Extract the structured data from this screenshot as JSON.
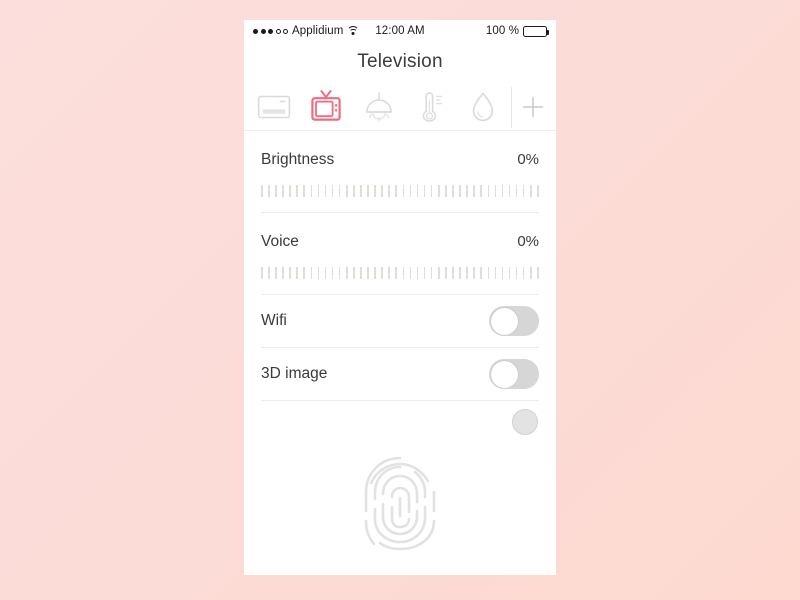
{
  "background": {
    "color_top_left": "#fcdedc",
    "color_bottom_right": "#fdd9d0"
  },
  "accent_color": "#f4697f",
  "status_bar": {
    "carrier": "Applidium",
    "signal_dots_filled": 3,
    "signal_dots_empty": 2,
    "wifi_icon": "wifi-icon",
    "time": "12:00 AM",
    "battery_percent": "100 %",
    "battery_icon": "battery-full-icon"
  },
  "nav": {
    "title": "Television"
  },
  "tabs": [
    {
      "name": "air-conditioner",
      "icon": "air-conditioner-icon",
      "selected": false
    },
    {
      "name": "television",
      "icon": "television-icon",
      "selected": true
    },
    {
      "name": "light",
      "icon": "lamp-icon",
      "selected": false
    },
    {
      "name": "temperature",
      "icon": "thermometer-icon",
      "selected": false
    },
    {
      "name": "humidity",
      "icon": "water-drop-icon",
      "selected": false
    }
  ],
  "add_button": {
    "icon": "plus-icon",
    "label": "+"
  },
  "sliders": [
    {
      "label": "Brightness",
      "value": "0%",
      "percent": 0,
      "tick_count": 40
    },
    {
      "label": "Voice",
      "value": "0%",
      "percent": 0,
      "tick_count": 40
    }
  ],
  "toggles": [
    {
      "label": "Wifi",
      "state": "off"
    },
    {
      "label": "3D image",
      "state": "off"
    }
  ],
  "loose_knob": {
    "name": "detached-toggle-knob"
  },
  "fingerprint": {
    "icon": "fingerprint-icon"
  }
}
